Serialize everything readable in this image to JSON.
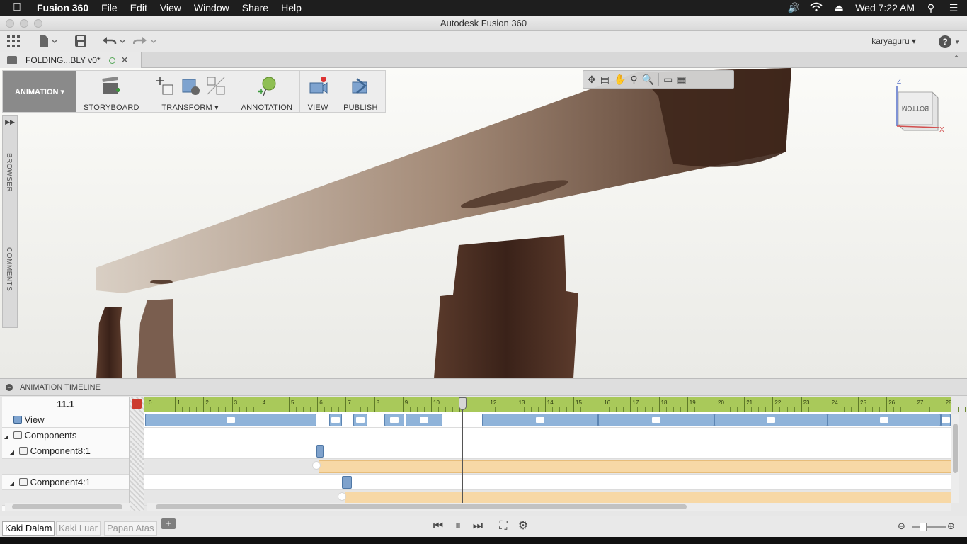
{
  "menubar": {
    "app_name": "Fusion 360",
    "items": [
      "File",
      "Edit",
      "View",
      "Window",
      "Share",
      "Help"
    ],
    "clock": "Wed 7:22 AM"
  },
  "window": {
    "title": "Autodesk Fusion 360"
  },
  "quickbar": {
    "user": "karyaguru ▾",
    "help": "?"
  },
  "doc_tab": {
    "name": "FOLDING...BLY v0*"
  },
  "toolbar": {
    "workspace": "ANIMATION ▾",
    "groups": [
      {
        "label": "STORYBOARD"
      },
      {
        "label": "TRANSFORM ▾"
      },
      {
        "label": "ANNOTATION"
      },
      {
        "label": "VIEW"
      },
      {
        "label": "PUBLISH"
      }
    ]
  },
  "side_panel": {
    "browser": "BROWSER",
    "comments": "COMMENTS"
  },
  "view_cube": {
    "face": "BOTTOM",
    "axis_z": "Z",
    "axis_x": "X"
  },
  "timeline": {
    "header": "ANIMATION TIMELINE",
    "current_time": "11.1",
    "ruler_labels": [
      "0",
      "1",
      "2",
      "3",
      "4",
      "5",
      "6",
      "7",
      "8",
      "9",
      "10",
      "11",
      "12",
      "13",
      "14",
      "15",
      "16",
      "17",
      "18",
      "19",
      "20",
      "21",
      "22",
      "23",
      "24",
      "25",
      "26",
      "27",
      "28"
    ],
    "rows": [
      {
        "label": "View",
        "type": "view"
      },
      {
        "label": "Components",
        "type": "group"
      },
      {
        "label": "Component8:1",
        "type": "component"
      },
      {
        "label": "",
        "type": "sub"
      },
      {
        "label": "Component4:1",
        "type": "component"
      },
      {
        "label": "",
        "type": "sub"
      }
    ],
    "playhead_time": 11.1
  },
  "storyboards": [
    "Kaki Dalam",
    "Kaki Luar",
    "Papan Atas"
  ],
  "add_storyboard": "+",
  "colors": {
    "ruler": "#a9c95a",
    "clip": "#8fb3d9",
    "opacity": "#f7d8a6",
    "marker": "#cc3b2e"
  }
}
